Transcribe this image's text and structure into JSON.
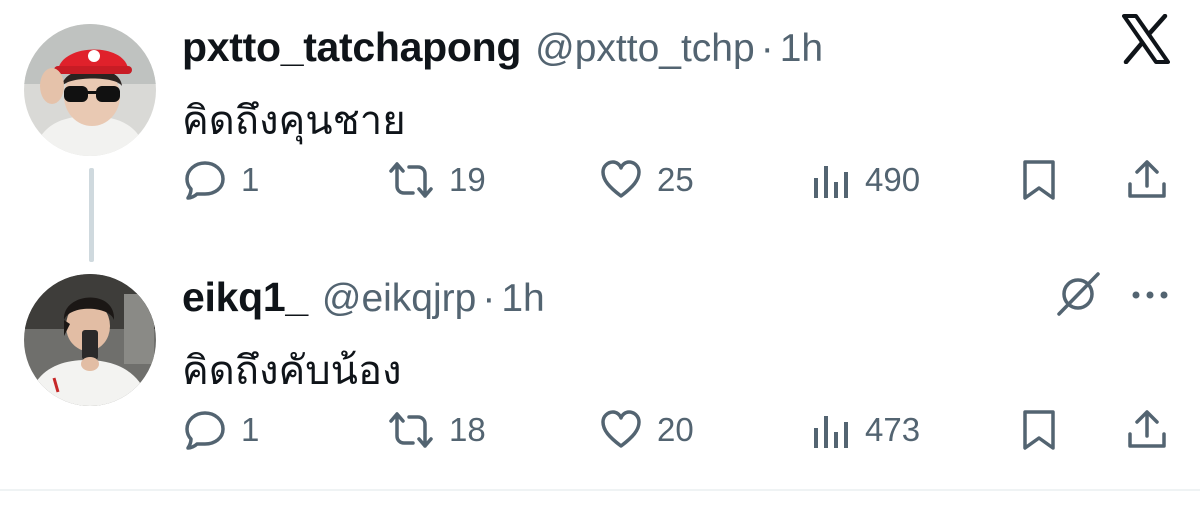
{
  "tweets": [
    {
      "display_name": "pxtto_tatchapong",
      "handle": "@pxtto_tchp",
      "separator": "·",
      "time": "1h",
      "text": "คิดถึงคุนชาย",
      "replies": "1",
      "reposts": "19",
      "likes": "25",
      "views": "490"
    },
    {
      "display_name": "eikq1_",
      "handle": "@eikqjrp",
      "separator": "·",
      "time": "1h",
      "text": "คิดถึงคับน้อง",
      "replies": "1",
      "reposts": "18",
      "likes": "20",
      "views": "473"
    }
  ],
  "icons": {
    "brand": "x-logo-icon",
    "reply": "speech-bubble-icon",
    "repost": "repost-arrows-icon",
    "like": "heart-icon",
    "views": "bar-chart-icon",
    "bookmark": "bookmark-icon",
    "share": "share-upload-icon",
    "grok": "grok-slash-icon",
    "more": "more-dots-icon"
  },
  "colors": {
    "text": "#0f1419",
    "secondary": "#536471",
    "thread_line": "#cfd9de",
    "avatar1_cap": "#e0212b"
  }
}
